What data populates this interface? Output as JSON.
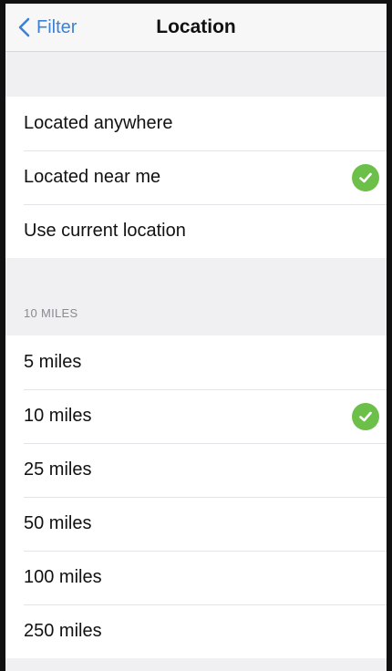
{
  "navbar": {
    "back_label": "Filter",
    "title": "Location"
  },
  "location_options": [
    {
      "label": "Located anywhere",
      "selected": false
    },
    {
      "label": "Located near me",
      "selected": true
    },
    {
      "label": "Use current location",
      "selected": false
    }
  ],
  "distance_section": {
    "header": "10 MILES",
    "options": [
      {
        "label": "5 miles",
        "selected": false
      },
      {
        "label": "10 miles",
        "selected": true
      },
      {
        "label": "25 miles",
        "selected": false
      },
      {
        "label": "50 miles",
        "selected": false
      },
      {
        "label": "100 miles",
        "selected": false
      },
      {
        "label": "250 miles",
        "selected": false
      }
    ]
  },
  "colors": {
    "accent": "#3b82d6",
    "checkmark": "#6cc04a"
  },
  "icons": {
    "back": "chevron-left-icon",
    "selected": "checkmark-circle-icon"
  }
}
